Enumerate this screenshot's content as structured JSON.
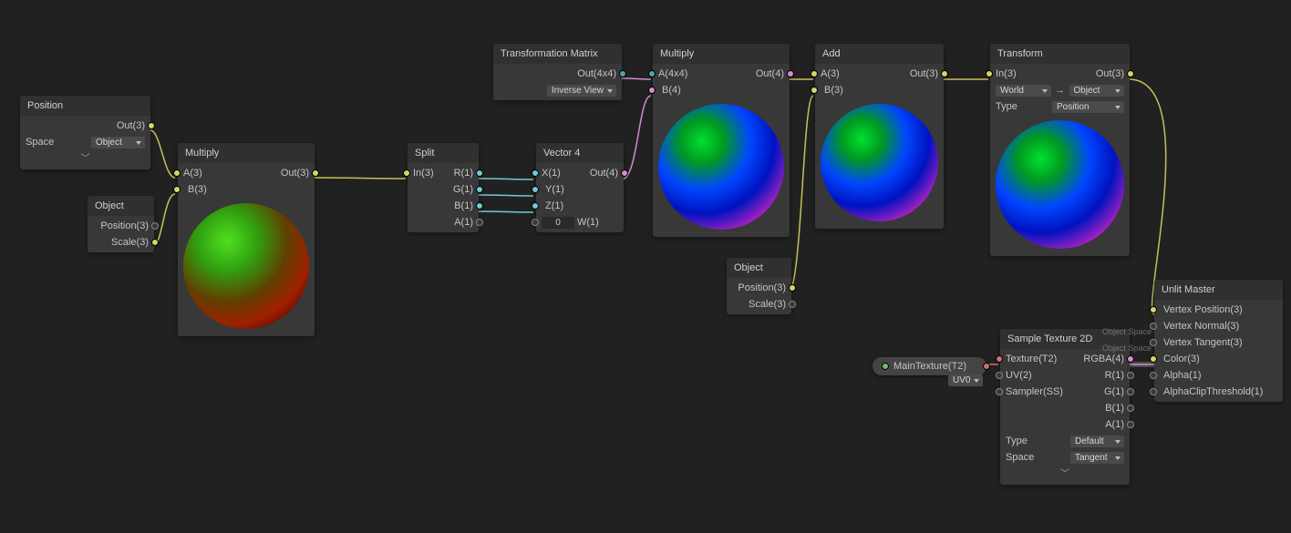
{
  "nodes": {
    "position": {
      "title": "Position",
      "out": "Out(3)",
      "spaceLabel": "Space",
      "spaceValue": "Object"
    },
    "object1": {
      "title": "Object",
      "position": "Position(3)",
      "scale": "Scale(3)"
    },
    "multiply1": {
      "title": "Multiply",
      "a": "A(3)",
      "b": "B(3)",
      "out": "Out(3)"
    },
    "split": {
      "title": "Split",
      "in": "In(3)",
      "r": "R(1)",
      "g": "G(1)",
      "b": "B(1)",
      "a": "A(1)"
    },
    "vector4": {
      "title": "Vector 4",
      "x": "X(1)",
      "y": "Y(1)",
      "z": "Z(1)",
      "w": "W(1)",
      "wval": "0",
      "out": "Out(4)"
    },
    "transMatrix": {
      "title": "Transformation Matrix",
      "out": "Out(4x4)",
      "mode": "Inverse View"
    },
    "multiply2": {
      "title": "Multiply",
      "a": "A(4x4)",
      "b": "B(4)",
      "out": "Out(4)"
    },
    "add": {
      "title": "Add",
      "a": "A(3)",
      "b": "B(3)",
      "out": "Out(3)"
    },
    "object2": {
      "title": "Object",
      "position": "Position(3)",
      "scale": "Scale(3)"
    },
    "transform": {
      "title": "Transform",
      "in": "In(3)",
      "out": "Out(3)",
      "from": "World",
      "to": "Object",
      "typeLabel": "Type",
      "typeValue": "Position"
    },
    "sample": {
      "title": "Sample Texture 2D",
      "tex": "Texture(T2)",
      "uv": "UV(2)",
      "sampler": "Sampler(SS)",
      "rgba": "RGBA(4)",
      "r": "R(1)",
      "g": "G(1)",
      "b": "B(1)",
      "a": "A(1)",
      "typeLabel": "Type",
      "typeValue": "Default",
      "spaceLabel": "Space",
      "spaceValue": "Tangent",
      "uvDrop": "UV0"
    },
    "unlit": {
      "title": "Unlit Master",
      "vpos": "Vertex Position(3)",
      "vnorm": "Vertex Normal(3)",
      "vtan": "Vertex Tangent(3)",
      "color": "Color(3)",
      "alpha": "Alpha(1)",
      "clip": "AlphaClipThreshold(1)",
      "objspace": "Object Space"
    },
    "mainTex": {
      "label": "MainTexture(T2)"
    }
  }
}
